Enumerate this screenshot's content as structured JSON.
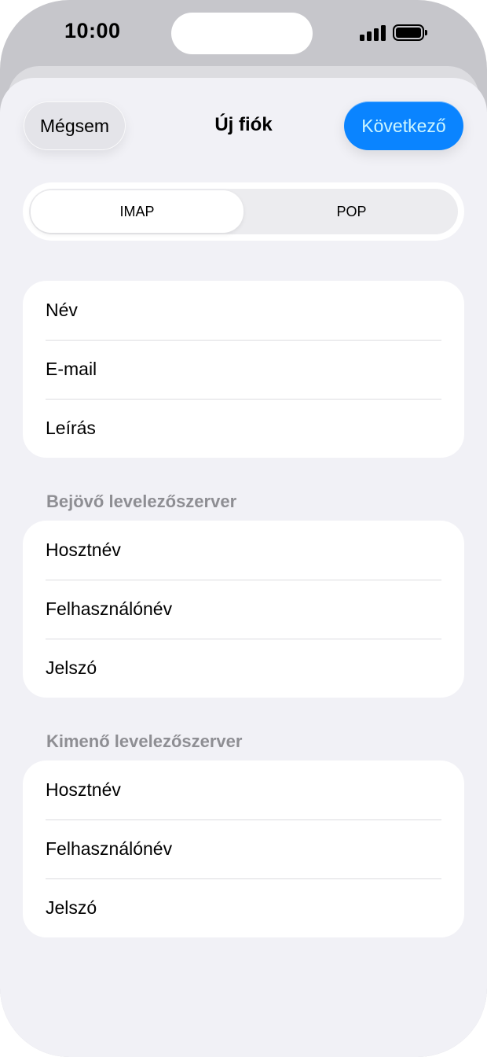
{
  "status_bar": {
    "time": "10:00",
    "signal_icon": "cellular-signal-icon",
    "battery_icon": "battery-full-icon"
  },
  "nav": {
    "cancel_label": "Mégsem",
    "title": "Új fiók",
    "next_label": "Következő"
  },
  "segments": {
    "items": [
      "IMAP",
      "POP"
    ],
    "selected": "IMAP"
  },
  "account_fields": [
    "Név",
    "E-mail",
    "Leírás"
  ],
  "incoming": {
    "header": "Bejövő levelezőszerver",
    "fields": [
      "Hosztnév",
      "Felhasználónév",
      "Jelszó"
    ]
  },
  "outgoing": {
    "header": "Kimenő levelezőszerver",
    "fields": [
      "Hosztnév",
      "Felhasználónév",
      "Jelszó"
    ]
  },
  "colors": {
    "accent": "#0a84ff",
    "accent_text": "#cdf6ff",
    "background": "#f1f1f6",
    "section_header": "#8e8e93"
  }
}
